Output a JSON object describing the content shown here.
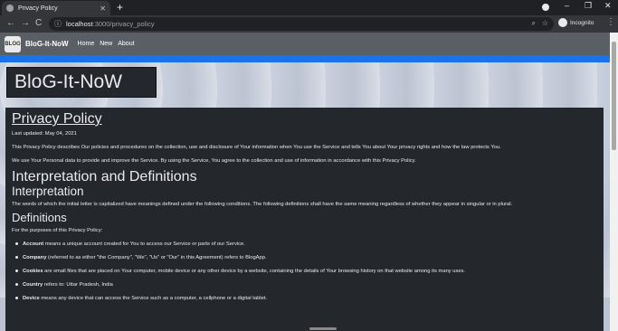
{
  "browser": {
    "tab_title": "Privacy Policy",
    "tab_close": "✕",
    "new_tab": "+",
    "url_host": "localhost",
    "url_port_path": ":3000/privacy_policy",
    "profile_label": "Incognito",
    "min": "–",
    "max": "❐",
    "close": "✕",
    "back": "←",
    "forward": "→",
    "reload": "C",
    "info_icon": "ⓘ",
    "zoom_icon": "⌕",
    "star_icon": "☆",
    "menu_icon": "⋮"
  },
  "navbar": {
    "logo_text": "BLOG",
    "brand": "BloG-It-NoW",
    "links": [
      "Home",
      "New",
      "About"
    ]
  },
  "banner": {
    "title": "BloG-It-NoW"
  },
  "content": {
    "title": "Privacy Policy",
    "updated": "Last updated: May 04, 2021",
    "intro1": "This Privacy Policy describes Our policies and procedures on the collection, use and disclosure of Your information when You use the Service and tells You about Your privacy rights and how the law protects You.",
    "intro2": "We use Your Personal data to provide and improve the Service. By using the Service, You agree to the collection and use of information in accordance with this Privacy Policy.",
    "h_interp_defs": "Interpretation and Definitions",
    "h_interp": "Interpretation",
    "interp_text": "The words of which the initial letter is capitalized have meanings defined under the following conditions. The following definitions shall have the same meaning regardless of whether they appear in singular or in plural.",
    "h_defs": "Definitions",
    "defs_intro": "For the purposes of this Privacy Policy:",
    "defs": [
      {
        "term": "Account",
        "text": " means a unique account created for You to access our Service or parts of our Service."
      },
      {
        "term": "Company",
        "text": " (referred to as either \"the Company\", \"We\", \"Us\" or \"Our\" in this Agreement) refers to BlogApp."
      },
      {
        "term": "Cookies",
        "text": " are small files that are placed on Your computer, mobile device or any other device by a website, containing the details of Your browsing history on that website among its many uses."
      },
      {
        "term": "Country",
        "text": " refers to: Uttar Pradesh, India"
      },
      {
        "term": "Device",
        "text": " means any device that can access the Service such as a computer, a cellphone or a digital tablet."
      }
    ]
  }
}
